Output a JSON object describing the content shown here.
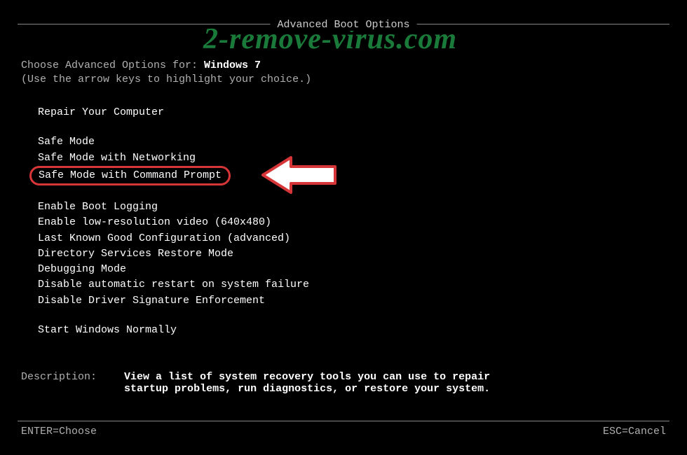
{
  "title": "Advanced Boot Options",
  "watermark": "2-remove-virus.com",
  "chooseLabel": "Choose Advanced Options for: ",
  "osName": "Windows 7",
  "hint": "(Use the arrow keys to highlight your choice.)",
  "menu": {
    "repair": "Repair Your Computer",
    "safeMode": "Safe Mode",
    "safeModeNet": "Safe Mode with Networking",
    "safeModeCmd": "Safe Mode with Command Prompt",
    "bootLogging": "Enable Boot Logging",
    "lowRes": "Enable low-resolution video (640x480)",
    "lastKnown": "Last Known Good Configuration (advanced)",
    "dsRestore": "Directory Services Restore Mode",
    "debugging": "Debugging Mode",
    "noAutoRestart": "Disable automatic restart on system failure",
    "noDriverSig": "Disable Driver Signature Enforcement",
    "startNormal": "Start Windows Normally"
  },
  "descLabel": "Description:",
  "descText": "View a list of system recovery tools you can use to repair startup problems, run diagnostics, or restore your system.",
  "footer": {
    "enter": "ENTER=Choose",
    "esc": "ESC=Cancel"
  }
}
